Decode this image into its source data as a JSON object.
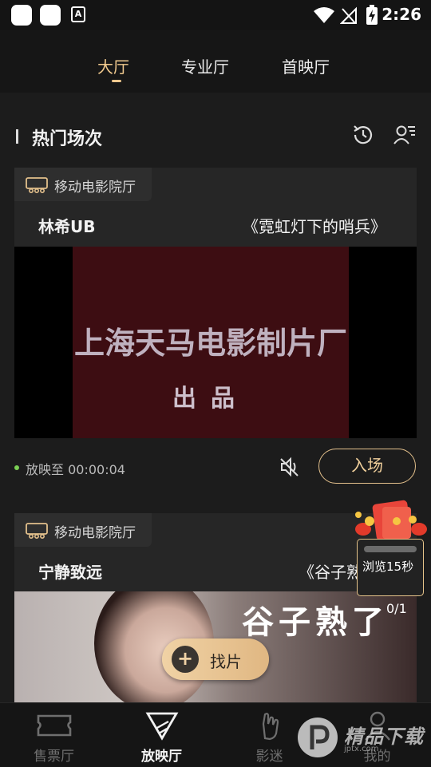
{
  "status_bar": {
    "time": "2:26",
    "a_icon_label": "A"
  },
  "tabs": [
    {
      "label": "大厅",
      "active": true
    },
    {
      "label": "专业厅",
      "active": false
    },
    {
      "label": "首映厅",
      "active": false
    }
  ],
  "section": {
    "title": "热门场次"
  },
  "cards": [
    {
      "hall_tag": "移动电影院厅",
      "user_name": "林希UB",
      "movie_title": "《霓虹灯下的哨兵》",
      "frame_text_main": "上海天马电影制片厂",
      "frame_text_sub": "出品",
      "play_status": "放映至 00:00:04",
      "enter_label": "入场"
    },
    {
      "hall_tag": "移动电影院厅",
      "user_name": "宁静致远",
      "movie_title": "《谷子熟",
      "frame_title": "谷子熟了",
      "frame_count": "0/1"
    }
  ],
  "find_button": {
    "label": "找片"
  },
  "reward": {
    "text": "浏览15秒"
  },
  "bottom_nav": [
    {
      "label": "售票厅",
      "icon": "ticket-icon",
      "active": false
    },
    {
      "label": "放映厅",
      "icon": "projector-icon",
      "active": true
    },
    {
      "label": "影迷",
      "icon": "hand-icon",
      "active": false
    },
    {
      "label": "我的",
      "icon": "profile-icon",
      "active": false
    }
  ],
  "watermark": {
    "text": "精品下载",
    "sub": "jptx.com"
  },
  "colors": {
    "accent": "#f0c98e",
    "background": "#161616",
    "card": "#262626",
    "live_dot": "#7bcf54"
  }
}
